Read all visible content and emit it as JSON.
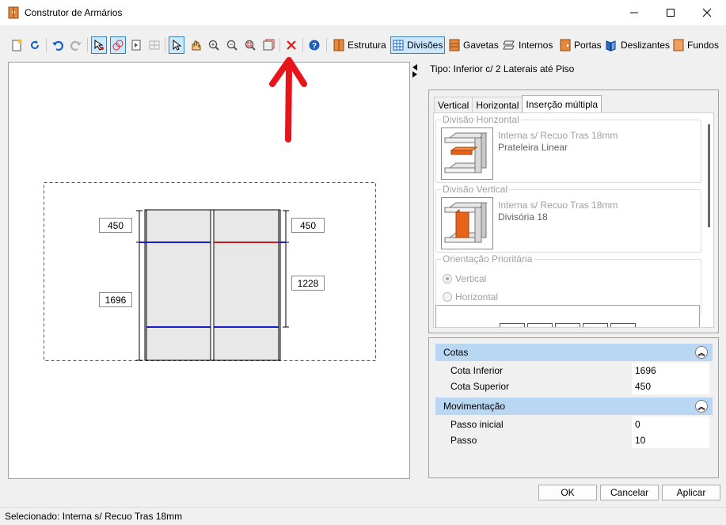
{
  "window": {
    "title": "Construtor de Armários",
    "icons": {
      "app": "cabinet-icon",
      "minimize": "minimize-icon",
      "maximize": "maximize-icon",
      "close": "close-icon"
    }
  },
  "toolbar": {
    "buttons": [
      "new-icon",
      "refresh-icon",
      "undo-icon",
      "redo-icon",
      "select-node-icon",
      "select-link-icon",
      "export-icon",
      "grid-icon",
      "pointer-icon",
      "pan-icon",
      "zoom-in-icon",
      "zoom-out-icon",
      "zoom-fit-icon",
      "frame-icon",
      "delete-icon",
      "help-icon"
    ],
    "tabs": [
      {
        "label": "Estrutura",
        "icon": "structure-icon"
      },
      {
        "label": "Divisões",
        "icon": "divisions-icon"
      },
      {
        "label": "Gavetas",
        "icon": "drawers-icon"
      },
      {
        "label": "Internos",
        "icon": "internals-icon"
      },
      {
        "label": "Portas",
        "icon": "doors-icon"
      },
      {
        "label": "Deslizantes",
        "icon": "sliding-icon"
      },
      {
        "label": "Fundos",
        "icon": "backs-icon"
      }
    ],
    "active_tab": "Divisões"
  },
  "canvas": {
    "dimensions": {
      "left_top": "450",
      "left_bottom": "1696",
      "right_top": "450",
      "right_bottom": "1228"
    }
  },
  "annotation": {
    "arrow_color": "#e8141c"
  },
  "panel": {
    "type_label": "Tipo: Inferior c/ 2 Laterais até Piso",
    "tabs": [
      "Vertical",
      "Horizontal",
      "Inserção múltipla"
    ],
    "active_tab": "Inserção múltipla",
    "groups": {
      "horizontal": {
        "title": "Divisão Horizontal",
        "line1": "Interna s/ Recuo Tras 18mm",
        "line2": "Prateleira Linear"
      },
      "vertical": {
        "title": "Divisão Vertical",
        "line1": "Interna s/ Recuo Tras 18mm",
        "line2": "Divisória 18"
      },
      "orientation": {
        "title": "Orientação Prioritária",
        "options": [
          "Vertical",
          "Horizontal"
        ],
        "selected": "Vertical"
      }
    }
  },
  "properties": {
    "sections": [
      {
        "title": "Cotas",
        "rows": [
          {
            "name": "Cota Inferior",
            "value": "1696"
          },
          {
            "name": "Cota Superior",
            "value": "450"
          }
        ]
      },
      {
        "title": "Movimentação",
        "rows": [
          {
            "name": "Passo inicial",
            "value": "0"
          },
          {
            "name": "Passo",
            "value": "10"
          }
        ]
      }
    ]
  },
  "buttons": {
    "ok": "OK",
    "cancel": "Cancelar",
    "apply": "Aplicar"
  },
  "status": "Selecionado: Interna s/ Recuo Tras 18mm",
  "colors": {
    "accent": "#3c7fb1",
    "section": "#b9d7f2",
    "divider_blue": "#1a1ad0",
    "divider_red": "#d01a1a",
    "orange": "#f07820"
  }
}
